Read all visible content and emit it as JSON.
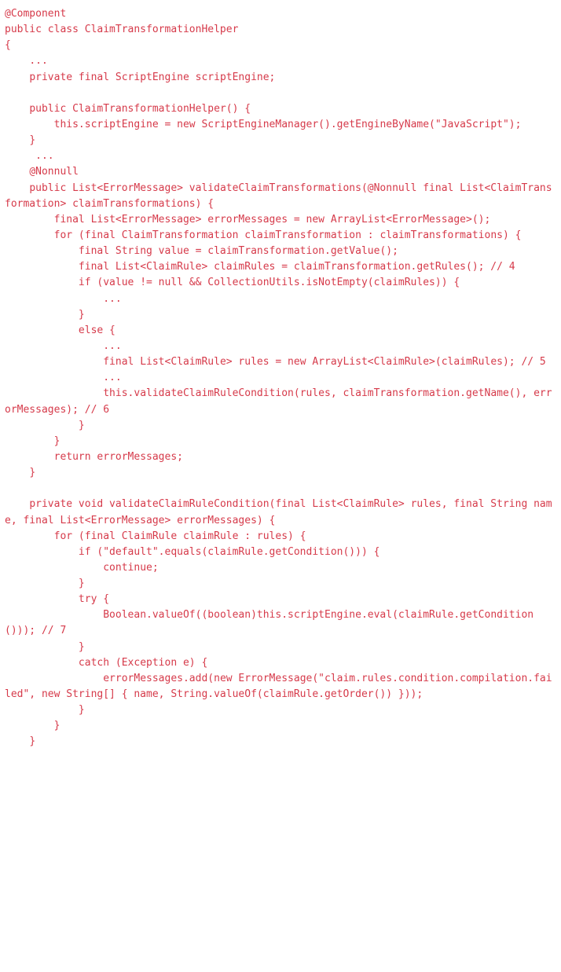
{
  "code": {
    "color": "#d63a4a",
    "lines": [
      "@Component",
      "public class ClaimTransformationHelper",
      "{",
      "    ...",
      "    private final ScriptEngine scriptEngine;",
      "",
      "    public ClaimTransformationHelper() {",
      "        this.scriptEngine = new ScriptEngineManager().getEngineByName(\"JavaScript\");",
      "    }",
      "     ...",
      "    @Nonnull",
      "    public List<ErrorMessage> validateClaimTransformations(@Nonnull final List<ClaimTransformation> claimTransformations) {",
      "        final List<ErrorMessage> errorMessages = new ArrayList<ErrorMessage>();",
      "        for (final ClaimTransformation claimTransformation : claimTransformations) {",
      "            final String value = claimTransformation.getValue();",
      "            final List<ClaimRule> claimRules = claimTransformation.getRules(); // 4",
      "            if (value != null && CollectionUtils.isNotEmpty(claimRules)) {",
      "                ...",
      "            }",
      "            else {",
      "                ...",
      "                final List<ClaimRule> rules = new ArrayList<ClaimRule>(claimRules); // 5",
      "                ...",
      "                this.validateClaimRuleCondition(rules, claimTransformation.getName(), errorMessages); // 6",
      "            }",
      "        }",
      "        return errorMessages;",
      "    }",
      "",
      "    private void validateClaimRuleCondition(final List<ClaimRule> rules, final String name, final List<ErrorMessage> errorMessages) {",
      "        for (final ClaimRule claimRule : rules) {",
      "            if (\"default\".equals(claimRule.getCondition())) {",
      "                continue;",
      "            }",
      "            try {",
      "                Boolean.valueOf((boolean)this.scriptEngine.eval(claimRule.getCondition())); // 7",
      "            }",
      "            catch (Exception e) {",
      "                errorMessages.add(new ErrorMessage(\"claim.rules.condition.compilation.failed\", new String[] { name, String.valueOf(claimRule.getOrder()) }));",
      "            }",
      "        }",
      "    }"
    ]
  }
}
